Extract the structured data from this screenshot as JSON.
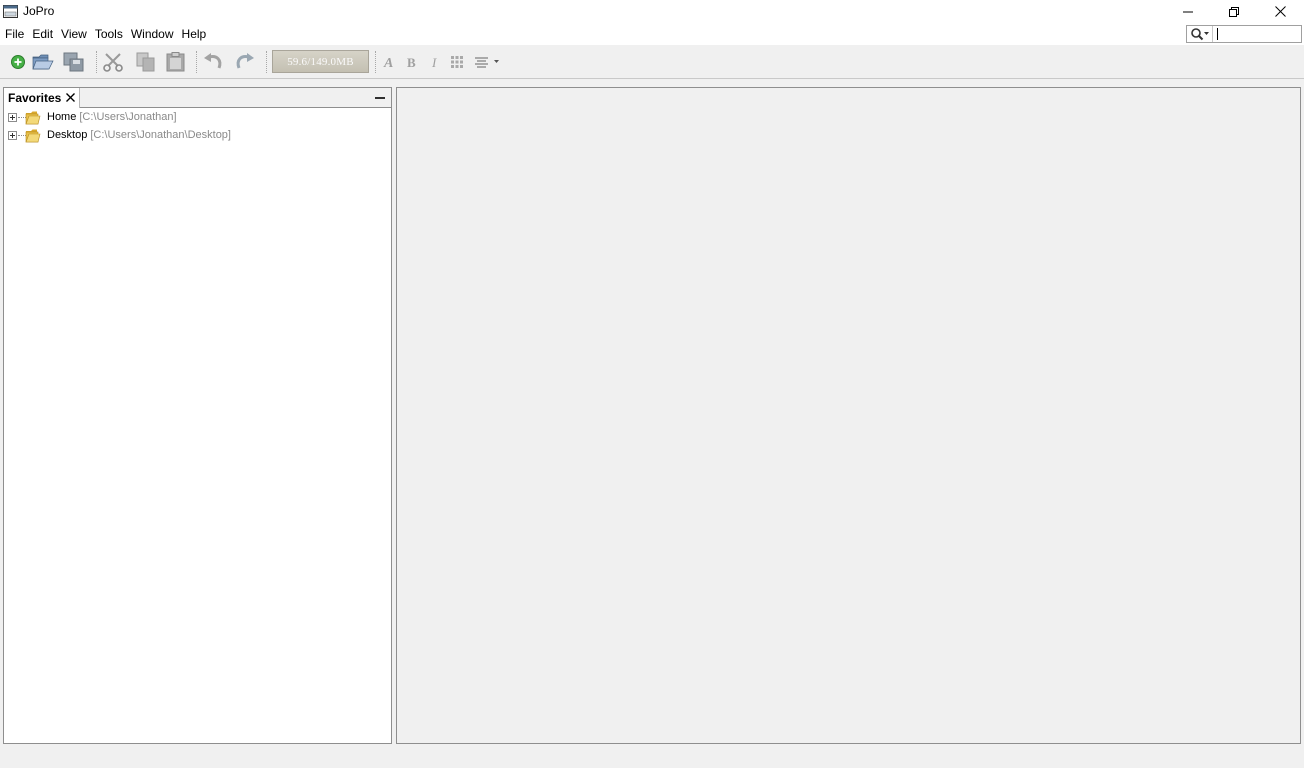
{
  "window": {
    "title": "JoPro",
    "icon": "app-window-icon",
    "controls": [
      "minimize-icon",
      "restore-icon",
      "close-icon"
    ]
  },
  "menubar": {
    "items": [
      "File",
      "Edit",
      "View",
      "Tools",
      "Window",
      "Help"
    ]
  },
  "search": {
    "icon": "search-icon",
    "value": "",
    "placeholder": ""
  },
  "toolbar": {
    "buttons": [
      "new-icon",
      "open-folder-icon",
      "save-all-icon",
      "cut-icon",
      "copy-icon",
      "paste-icon",
      "undo-icon",
      "redo-icon",
      "font-icon",
      "bold-icon",
      "italic-icon",
      "grid-icon",
      "align-icon"
    ],
    "memory": "59.6/149.0MB"
  },
  "favorites": {
    "tab_label": "Favorites",
    "nodes": [
      {
        "label": "Home",
        "path": "[C:\\Users\\Jonathan]"
      },
      {
        "label": "Desktop",
        "path": "[C:\\Users\\Jonathan\\Desktop]"
      }
    ]
  },
  "colors": {
    "window_bg": "#f0f0f0",
    "panel_bg": "#ffffff",
    "border": "#8e8e8e",
    "muted_text": "#8a8a8a",
    "folder_yellow": "#e8c04a",
    "new_green": "#3aa13a"
  }
}
